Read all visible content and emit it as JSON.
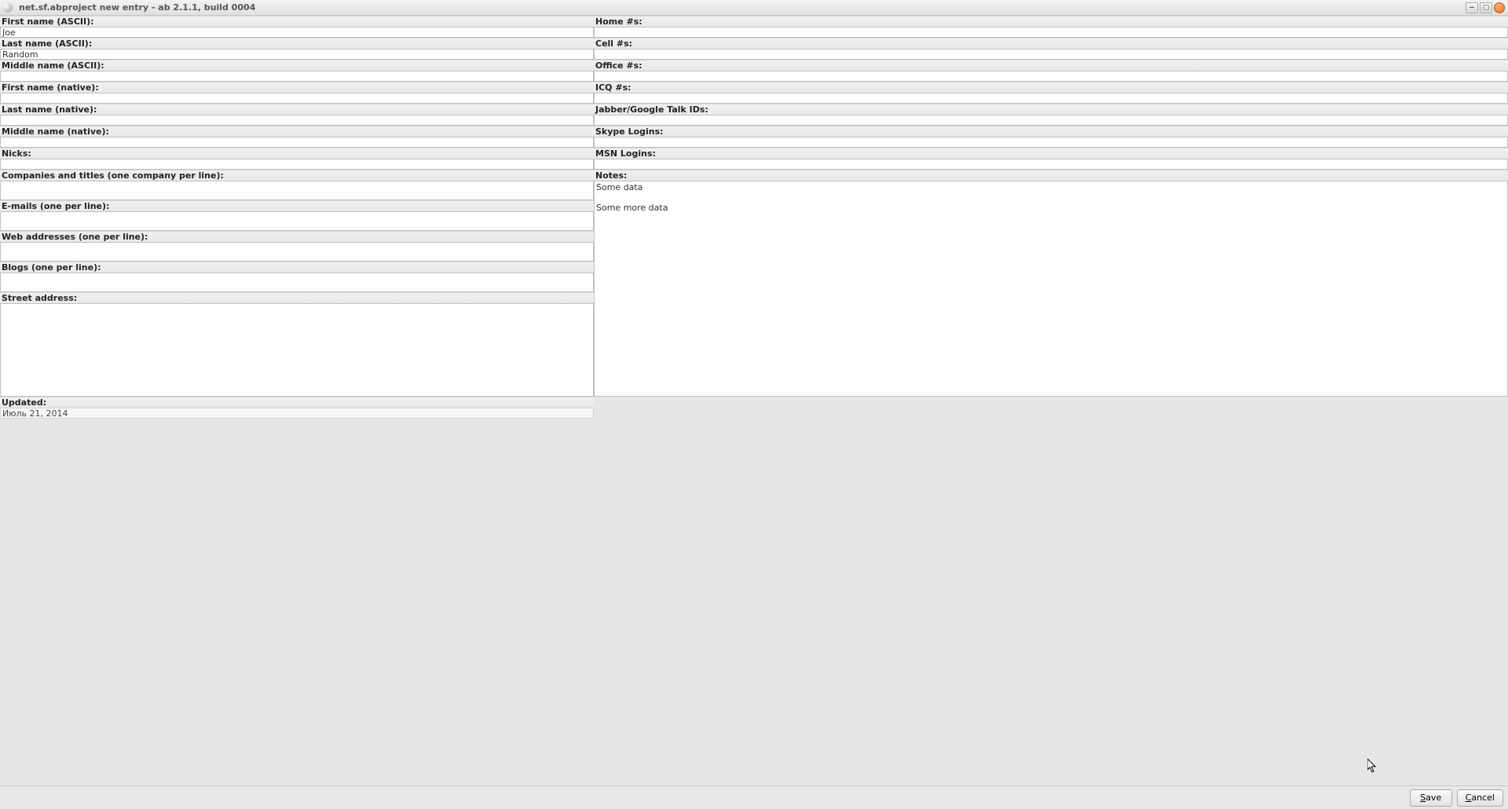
{
  "window": {
    "title": "net.sf.abproject new entry - ab 2.1.1, build 0004"
  },
  "left": {
    "first_name_ascii_label": "First name (ASCII):",
    "first_name_ascii_value": "Joe",
    "last_name_ascii_label": "Last name (ASCII):",
    "last_name_ascii_value": "Random",
    "middle_name_ascii_label": "Middle name (ASCII):",
    "middle_name_ascii_value": "",
    "first_name_native_label": "First name (native):",
    "first_name_native_value": "",
    "last_name_native_label": "Last name (native):",
    "last_name_native_value": "",
    "middle_name_native_label": "Middle name (native):",
    "middle_name_native_value": "",
    "nicks_label": "Nicks:",
    "nicks_value": "",
    "companies_label": "Companies and titles (one company per line):",
    "companies_value": "",
    "emails_label": "E-mails (one per line):",
    "emails_value": "",
    "web_label": "Web addresses (one per line):",
    "web_value": "",
    "blogs_label": "Blogs (one per line):",
    "blogs_value": "",
    "street_label": "Street address:",
    "street_value": "",
    "updated_label": "Updated:",
    "updated_value": "Июль 21, 2014"
  },
  "right": {
    "home_label": "Home #s:",
    "home_value": "",
    "cell_label": "Cell #s:",
    "cell_value": "",
    "office_label": "Office #s:",
    "office_value": "",
    "icq_label": "ICQ #s:",
    "icq_value": "",
    "jabber_label": "Jabber/Google Talk IDs:",
    "jabber_value": "",
    "skype_label": "Skype Logins:",
    "skype_value": "",
    "msn_label": "MSN Logins:",
    "msn_value": "",
    "notes_label": "Notes:",
    "notes_value": "Some data\n\nSome more data"
  },
  "buttons": {
    "save": "Save",
    "cancel": "Cancel"
  }
}
